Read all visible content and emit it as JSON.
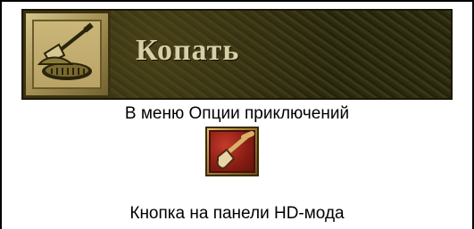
{
  "banner": {
    "title": "Копать",
    "icon": "shovel-icon"
  },
  "captions": {
    "adventure_menu": "В меню Опции приключений",
    "hd_panel": "Кнопка на панели HD-мода"
  },
  "hd_button": {
    "icon": "shovel-icon"
  },
  "colors": {
    "banner_bg": "#2f2c12",
    "banner_text": "#d9cfa6",
    "icon_frame_gold": "#b9a265",
    "hd_button_red": "#8a1d14"
  }
}
